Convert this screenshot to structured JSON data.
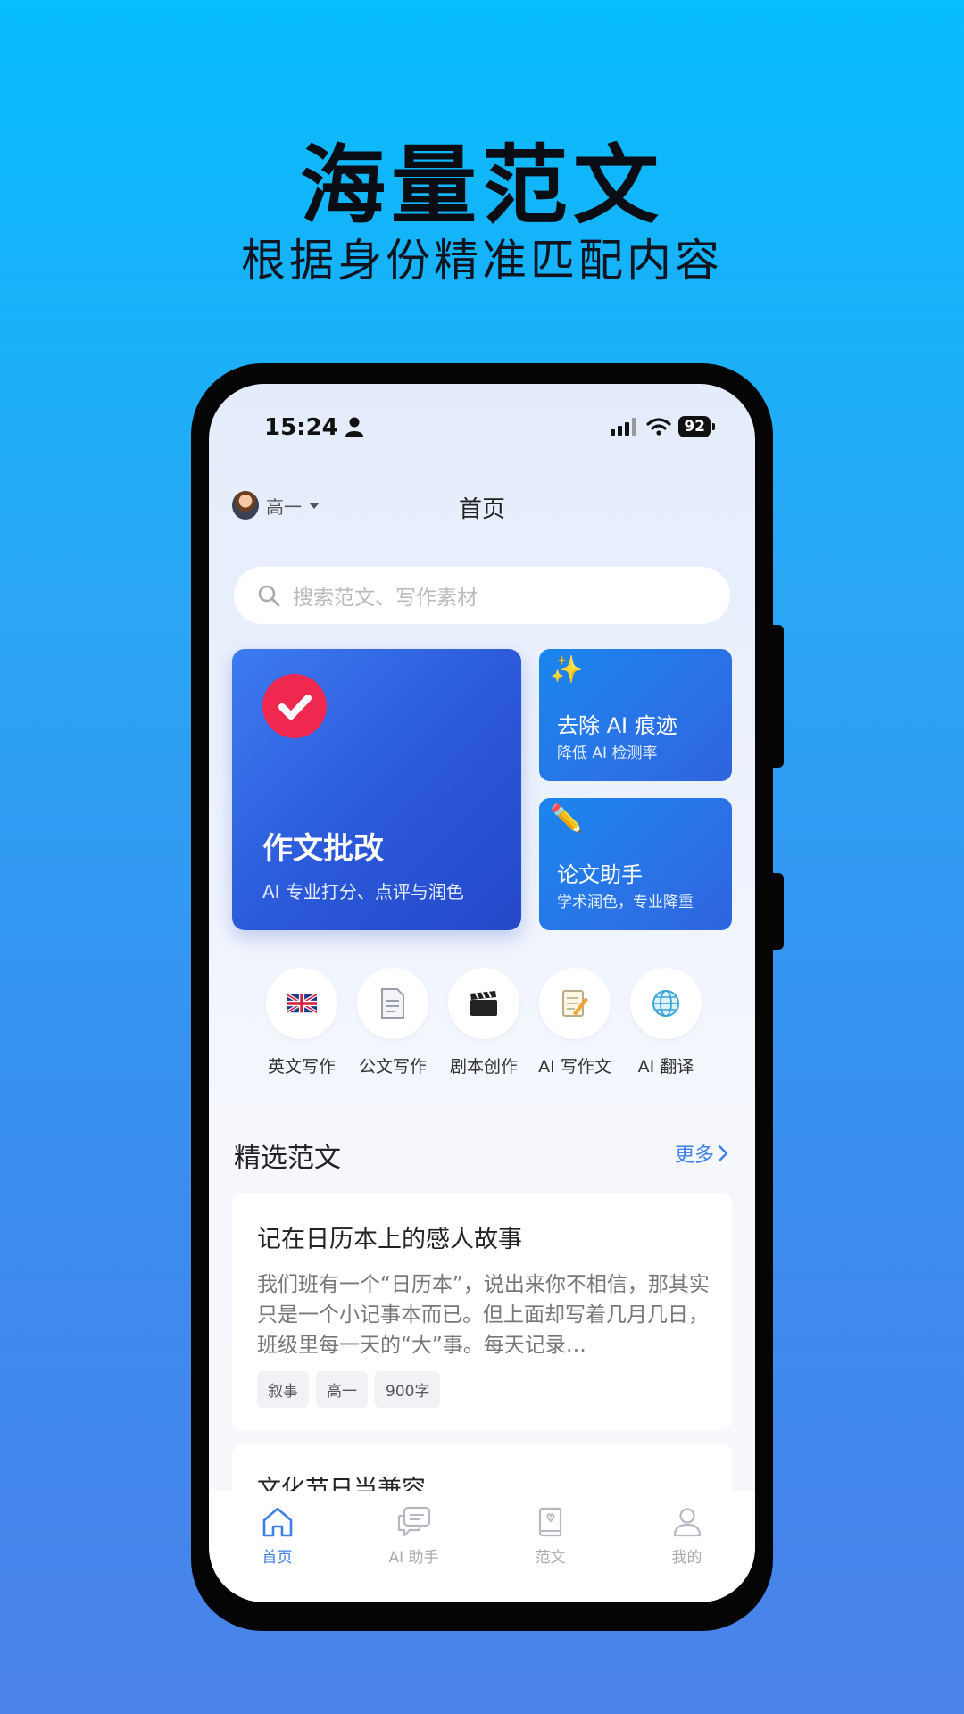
{
  "promo": {
    "title": "海量范文",
    "subtitle": "根据身份精准匹配内容"
  },
  "status_bar": {
    "time": "15:24",
    "battery": "92"
  },
  "header": {
    "grade": "高一",
    "title": "首页"
  },
  "search": {
    "placeholder": "搜索范文、写作素材"
  },
  "feature_cards": {
    "main": {
      "title": "作文批改",
      "subtitle": "AI 专业打分、点评与润色",
      "icon": "check-circle-icon"
    },
    "side": [
      {
        "title": "去除 AI 痕迹",
        "subtitle": "降低 AI 检测率",
        "icon": "eraser-icon"
      },
      {
        "title": "论文助手",
        "subtitle": "学术润色，专业降重",
        "icon": "magic-wand-icon"
      }
    ]
  },
  "shortcuts": [
    {
      "label": "英文写作",
      "icon": "uk-flag-icon"
    },
    {
      "label": "公文写作",
      "icon": "document-icon"
    },
    {
      "label": "剧本创作",
      "icon": "clapperboard-icon"
    },
    {
      "label": "AI 写作文",
      "icon": "memo-icon"
    },
    {
      "label": "AI 翻译",
      "icon": "globe-icon"
    }
  ],
  "featured": {
    "section_title": "精选范文",
    "more_label": "更多",
    "articles": [
      {
        "title": "记在日历本上的感人故事",
        "excerpt": "我们班有一个“日历本”，说出来你不相信，那其实只是一个小记事本而已。但上面却写着几月几日，班级里每一天的“大”事。每天记录…",
        "tags": [
          "叙事",
          "高一",
          "900字"
        ]
      },
      {
        "title": "文化节日当兼容"
      }
    ]
  },
  "tabbar": [
    {
      "label": "首页",
      "icon": "home-icon",
      "active": true
    },
    {
      "label": "AI 助手",
      "icon": "chat-icon",
      "active": false
    },
    {
      "label": "范文",
      "icon": "book-icon",
      "active": false
    },
    {
      "label": "我的",
      "icon": "user-icon",
      "active": false
    }
  ],
  "colors": {
    "accent": "#3b7fe8",
    "check_red": "#f0284f",
    "card_blue": "#2a58d8"
  }
}
